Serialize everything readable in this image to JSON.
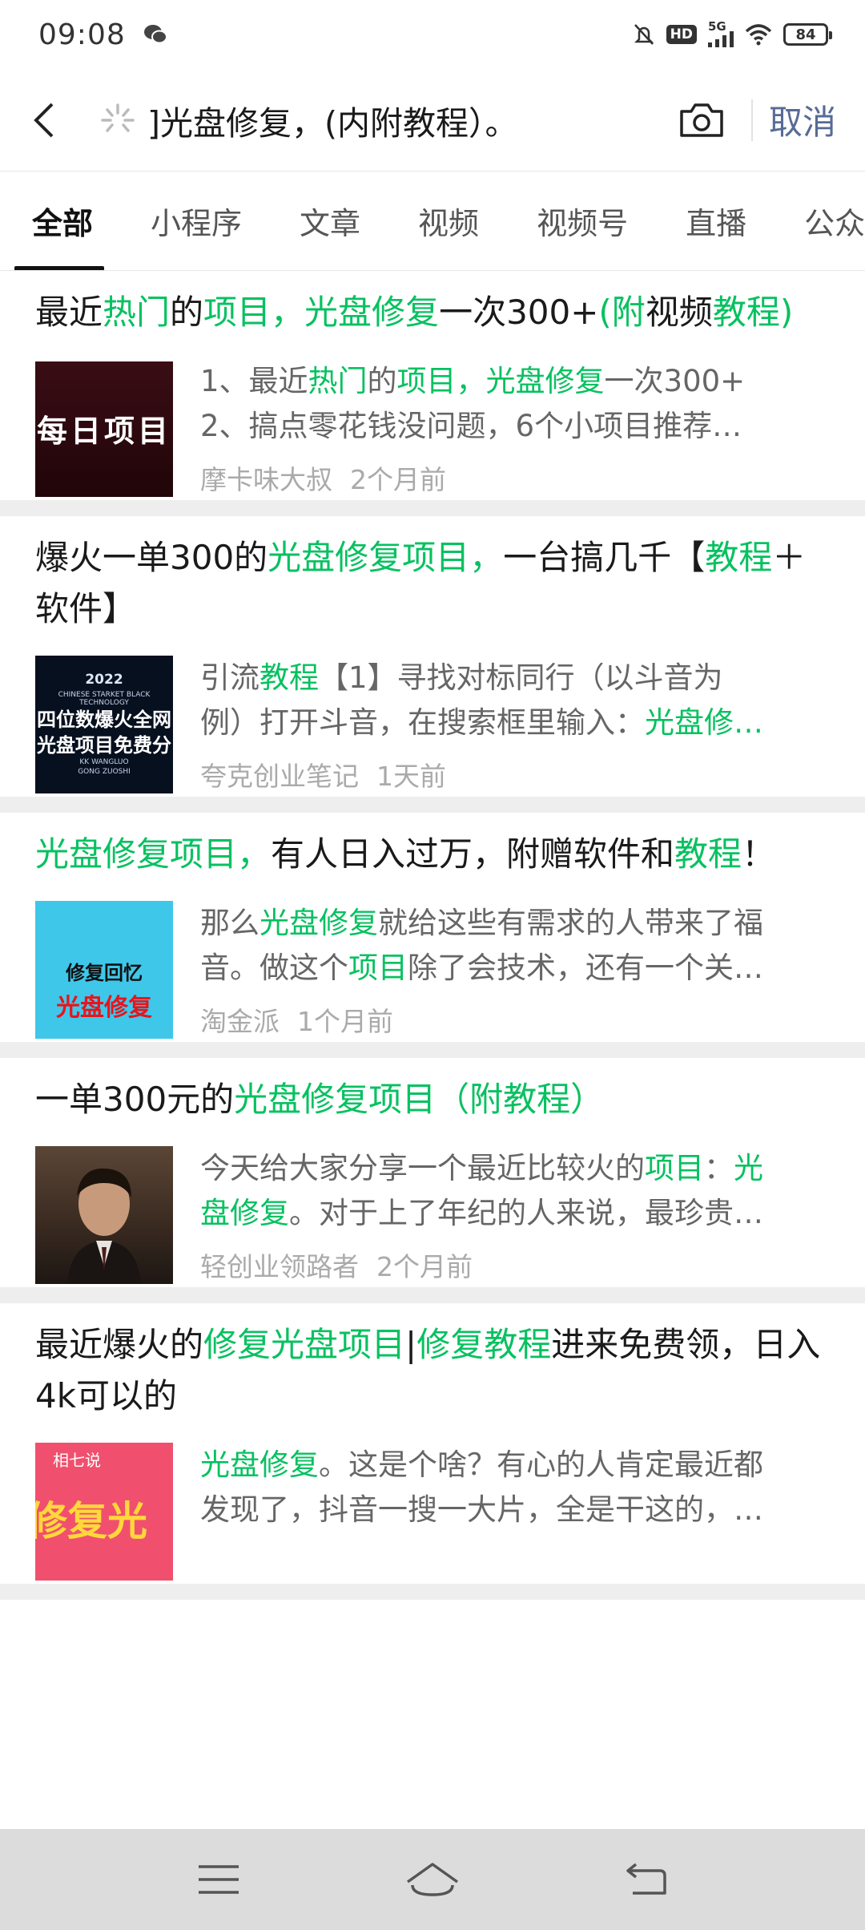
{
  "status_bar": {
    "time": "09:08",
    "network": "5G",
    "hd": "HD",
    "battery": "84"
  },
  "header": {
    "search_query": "]光盘修复，(内附教程）。",
    "cancel_label": "取消"
  },
  "tabs": [
    {
      "label": "全部",
      "active": true
    },
    {
      "label": "小程序"
    },
    {
      "label": "文章"
    },
    {
      "label": "视频"
    },
    {
      "label": "视频号"
    },
    {
      "label": "直播"
    },
    {
      "label": "公众号"
    }
  ],
  "results": [
    {
      "title_parts": [
        {
          "text": "最近",
          "hl": false
        },
        {
          "text": "热门",
          "hl": true
        },
        {
          "text": "的",
          "hl": false
        },
        {
          "text": "项目，光盘修复",
          "hl": true
        },
        {
          "text": "一次300+",
          "hl": false
        },
        {
          "text": "(附",
          "hl": true
        },
        {
          "text": "视频",
          "hl": false
        },
        {
          "text": "教程)",
          "hl": true
        }
      ],
      "snippet_lines": [
        [
          {
            "text": "1、最近",
            "hl": false
          },
          {
            "text": "热门",
            "hl": true
          },
          {
            "text": "的",
            "hl": false
          },
          {
            "text": "项目，光盘修复",
            "hl": true
          },
          {
            "text": "一次300+",
            "hl": false
          }
        ],
        [
          {
            "text": "2、搞点零花钱没问题，6个小项目推荐…",
            "hl": false
          }
        ]
      ],
      "thumb_text": "每日项目",
      "source": "摩卡味大叔",
      "time": "2个月前"
    },
    {
      "title_parts": [
        {
          "text": "爆火一单300的",
          "hl": false
        },
        {
          "text": "光盘修复项目，",
          "hl": true
        },
        {
          "text": "一台搞几千【",
          "hl": false
        },
        {
          "text": "教程",
          "hl": true
        },
        {
          "text": "＋软件】",
          "hl": false
        }
      ],
      "snippet_lines": [
        [
          {
            "text": "引流",
            "hl": false
          },
          {
            "text": "教程",
            "hl": true
          },
          {
            "text": "【1】寻找对标同行（以斗音为",
            "hl": false
          }
        ],
        [
          {
            "text": "例）打开斗音，在搜索框里输入：",
            "hl": false
          },
          {
            "text": "光盘修…",
            "hl": true
          }
        ]
      ],
      "thumb_text": {
        "year": "2022",
        "sub_top": "CHINESE STARKET BLACK TECHNOLOGY",
        "line1": "四位数爆火全网",
        "line2": "光盘项目免费分",
        "sub_bottom1": "KK WANGLUO",
        "sub_bottom2": "GONG ZUOSHI"
      },
      "source": "夸克创业笔记",
      "time": "1天前"
    },
    {
      "title_parts": [
        {
          "text": "光盘修复项目，",
          "hl": true
        },
        {
          "text": "有人日入过万，附赠软件和",
          "hl": false
        },
        {
          "text": "教程",
          "hl": true
        },
        {
          "text": "！",
          "hl": false
        }
      ],
      "snippet_lines": [
        [
          {
            "text": "那么",
            "hl": false
          },
          {
            "text": "光盘修复",
            "hl": true
          },
          {
            "text": "就给这些有需求的人带来了福",
            "hl": false
          }
        ],
        [
          {
            "text": "音。做这个",
            "hl": false
          },
          {
            "text": "项目",
            "hl": true
          },
          {
            "text": "除了会技术，还有一个关…",
            "hl": false
          }
        ]
      ],
      "thumb_text": {
        "line1": "修复回忆",
        "line2": "光盘修复"
      },
      "source": "淘金派",
      "time": "1个月前"
    },
    {
      "title_parts": [
        {
          "text": "一单300元的",
          "hl": false
        },
        {
          "text": "光盘修复项目（附教程）",
          "hl": true
        }
      ],
      "snippet_lines": [
        [
          {
            "text": "今天给大家分享一个最近比较火的",
            "hl": false
          },
          {
            "text": "项目",
            "hl": true
          },
          {
            "text": "：",
            "hl": false
          },
          {
            "text": "光",
            "hl": true
          }
        ],
        [
          {
            "text": "盘修复",
            "hl": true
          },
          {
            "text": "。对于上了年纪的人来说，最珍贵…",
            "hl": false
          }
        ]
      ],
      "source": "轻创业领路者",
      "time": "2个月前"
    },
    {
      "title_parts": [
        {
          "text": "最近爆火的",
          "hl": false
        },
        {
          "text": "修复光盘项目",
          "hl": true
        },
        {
          "text": "|",
          "hl": false
        },
        {
          "text": "修复教程",
          "hl": true
        },
        {
          "text": "进来免费领，日入4k可以的",
          "hl": false
        }
      ],
      "snippet_lines": [
        [
          {
            "text": "光盘修复",
            "hl": true
          },
          {
            "text": "。这是个啥？有心的人肯定最近都",
            "hl": false
          }
        ],
        [
          {
            "text": "发现了，抖音一搜一大片，全是干这的，…",
            "hl": false
          }
        ]
      ],
      "thumb_text": {
        "top": "相七说",
        "big": "修复光"
      },
      "source": "",
      "time": ""
    }
  ],
  "colors": {
    "highlight": "#07c160",
    "link": "#576b95",
    "divider": "#eeeeee"
  },
  "icons": [
    "wechat-icon",
    "mute-icon",
    "signal-icon",
    "wifi-icon",
    "back-icon",
    "loading-icon",
    "camera-icon",
    "menu-icon",
    "home-icon",
    "back-nav-icon"
  ]
}
